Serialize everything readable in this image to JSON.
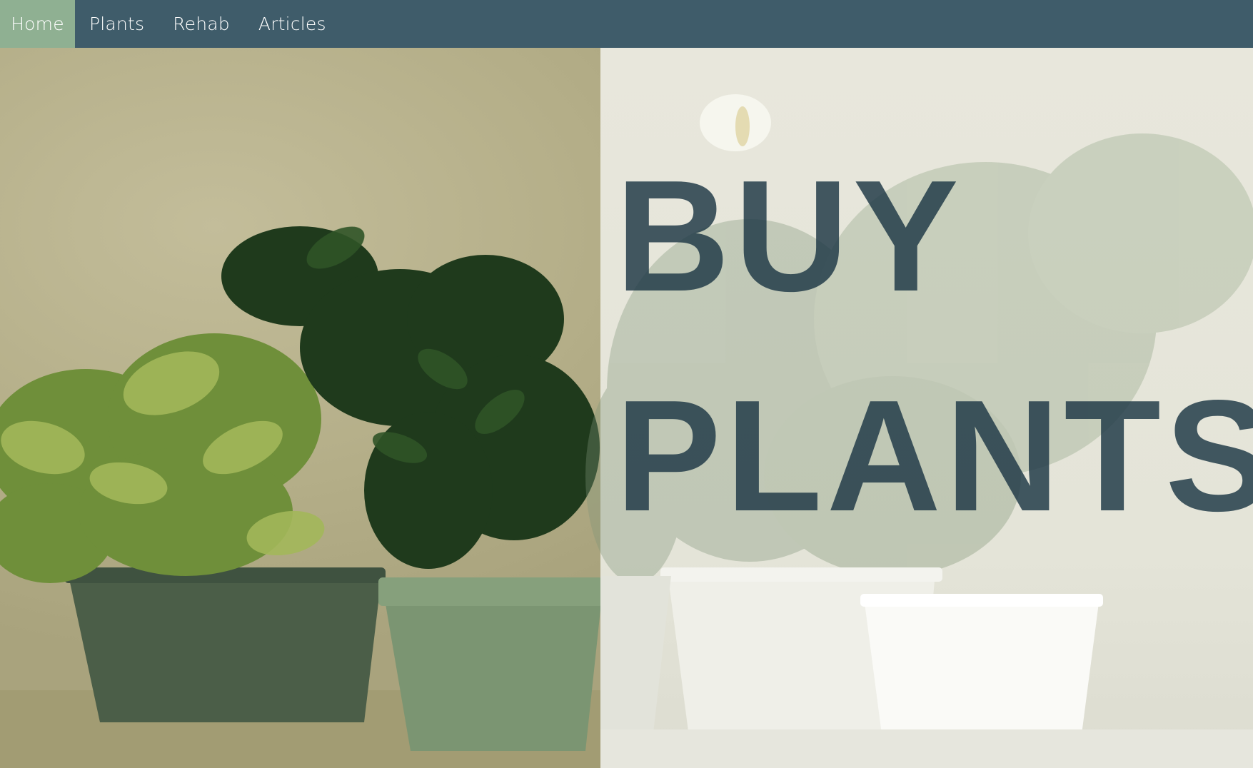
{
  "nav": {
    "items": [
      {
        "label": "Home",
        "active": true
      },
      {
        "label": "Plants",
        "active": false
      },
      {
        "label": "Rehab",
        "active": false
      },
      {
        "label": "Articles",
        "active": false
      }
    ]
  },
  "hero": {
    "headline_line1": "BUY",
    "headline_line2": "PLANTS"
  },
  "colors": {
    "nav_bg": "#3f5c6a",
    "nav_active": "#8fb092",
    "headline": "#1d3745"
  }
}
